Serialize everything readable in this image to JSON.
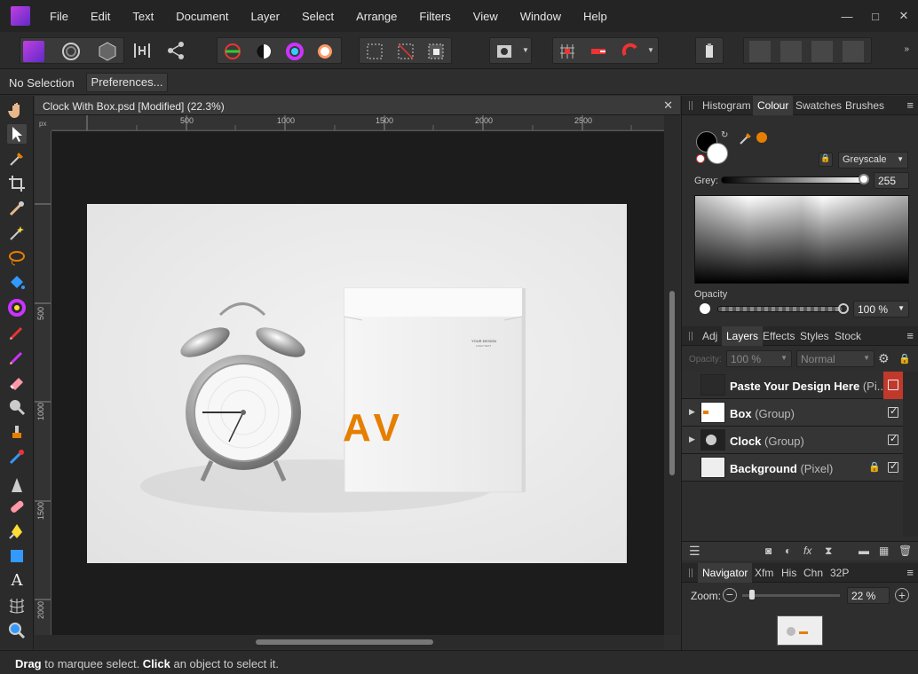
{
  "menu": [
    "File",
    "Edit",
    "Text",
    "Document",
    "Layer",
    "Select",
    "Arrange",
    "Filters",
    "View",
    "Window",
    "Help"
  ],
  "window_controls": {
    "minimize": "—",
    "maximize": "□",
    "close": "✕"
  },
  "context": {
    "selection": "No Selection",
    "preferences": "Preferences..."
  },
  "document": {
    "title": "Clock With Box.psd [Modified] (22.3%)",
    "close": "✕",
    "ruler_unit": "px",
    "ruler_top": [
      "500",
      "1000",
      "1500",
      "2000",
      "2500"
    ],
    "ruler_left": [
      "500",
      "1000",
      "1500",
      "2000"
    ]
  },
  "artwork": {
    "box_brand": "AV",
    "box_text_1": "YOUR DESIGN",
    "box_text_2": "LOGO TEXT"
  },
  "status": {
    "drag": "Drag",
    "t1": " to marquee select. ",
    "click": "Click",
    "t2": " an object to select it."
  },
  "colour_panel": {
    "tabs": [
      "Histogram",
      "Colour",
      "Swatches",
      "Brushes"
    ],
    "active": "Colour",
    "mode": "Greyscale",
    "grey_label": "Grey:",
    "grey_value": "255",
    "opacity_label": "Opacity",
    "opacity_value": "100 %",
    "accent": "#e67e00"
  },
  "layers_panel": {
    "tabs": [
      "Adj",
      "Layers",
      "Effects",
      "Styles",
      "Stock"
    ],
    "active": "Layers",
    "opacity_label": "Opacity:",
    "opacity_value": "100 %",
    "blend": "Normal",
    "layers": [
      {
        "name": "Paste Your Design Here",
        "kind": "(Pi...",
        "visible": false
      },
      {
        "name": "Box",
        "kind": "(Group)",
        "visible": true
      },
      {
        "name": "Clock",
        "kind": "(Group)",
        "visible": true
      },
      {
        "name": "Background",
        "kind": "(Pixel)",
        "visible": true
      }
    ]
  },
  "navigator_panel": {
    "tabs": [
      "Navigator",
      "Xfm",
      "His",
      "Chn",
      "32P"
    ],
    "active": "Navigator",
    "zoom_label": "Zoom:",
    "zoom_value": "22 %"
  }
}
